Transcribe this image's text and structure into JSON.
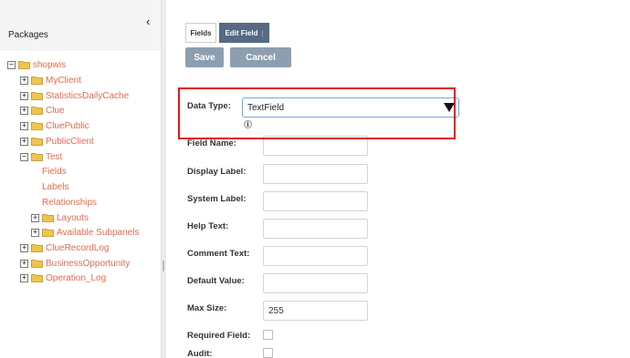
{
  "sidebar": {
    "title": "Packages",
    "collapse_icon": "chevron-left-icon",
    "collapse_glyph": "‹",
    "tree": [
      {
        "label": "shopwis",
        "expander": "−",
        "folder": true
      },
      {
        "label": "MyClient",
        "expander": "+",
        "folder": true
      },
      {
        "label": "StatisticsDailyCache",
        "expander": "+",
        "folder": true
      },
      {
        "label": "Clue",
        "expander": "+",
        "folder": true
      },
      {
        "label": "CluePublic",
        "expander": "+",
        "folder": true
      },
      {
        "label": "PublicClient",
        "expander": "+",
        "folder": true
      },
      {
        "label": "Test",
        "expander": "−",
        "folder": true
      },
      {
        "label": "Fields",
        "expander": "",
        "folder": false
      },
      {
        "label": "Labels",
        "expander": "",
        "folder": false
      },
      {
        "label": "Relationships",
        "expander": "",
        "folder": false
      },
      {
        "label": "Layouts",
        "expander": "+",
        "folder": true
      },
      {
        "label": "Available Subpanels",
        "expander": "+",
        "folder": true
      },
      {
        "label": "ClueRecordLog",
        "expander": "+",
        "folder": true
      },
      {
        "label": "BusinessOpportunity",
        "expander": "+",
        "folder": true
      },
      {
        "label": "Operation_Log",
        "expander": "+",
        "folder": true
      }
    ]
  },
  "tabs": {
    "fields": "Fields",
    "edit_field": "Edit Field",
    "edit_sep": "|"
  },
  "buttons": {
    "save": "Save",
    "cancel": "Cancel"
  },
  "form": {
    "data_type_label": "Data Type:",
    "data_type_value": "TextField",
    "info_glyph": "i",
    "field_name_label": "Field Name:",
    "field_name_value": "",
    "display_label_label": "Display Label:",
    "display_label_value": "",
    "system_label_label": "System Label:",
    "system_label_value": "",
    "help_text_label": "Help Text:",
    "help_text_value": "",
    "comment_text_label": "Comment Text:",
    "comment_text_value": "",
    "default_value_label": "Default Value:",
    "default_value_value": "",
    "max_size_label": "Max Size:",
    "max_size_value": "255",
    "required_label": "Required Field:",
    "audit_label": "Audit:"
  },
  "colors": {
    "tree_link": "#e66a4f",
    "tab_active": "#566a83",
    "button": "#8d9eb0",
    "highlight": "#e3141b",
    "folder": "#f2c44b"
  }
}
